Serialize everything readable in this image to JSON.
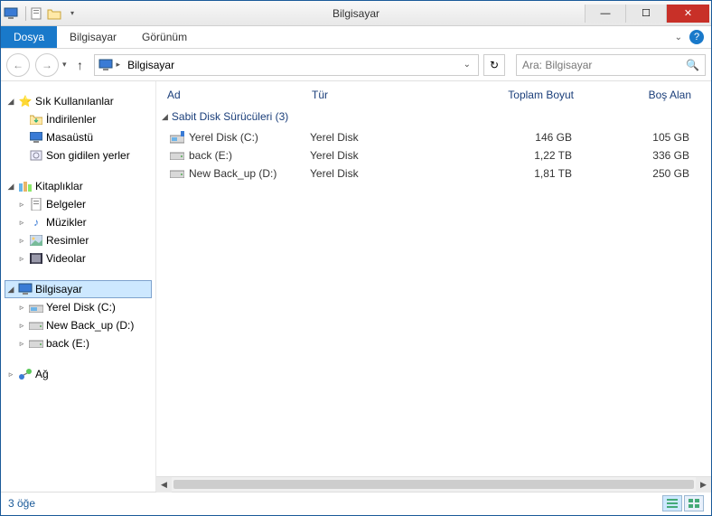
{
  "window": {
    "title": "Bilgisayar"
  },
  "ribbon": {
    "file": "Dosya",
    "tabs": [
      "Bilgisayar",
      "Görünüm"
    ]
  },
  "address": {
    "location": "Bilgisayar"
  },
  "search": {
    "placeholder": "Ara: Bilgisayar"
  },
  "tree": {
    "favorites": {
      "label": "Sık Kullanılanlar",
      "items": [
        {
          "label": "İndirilenler",
          "icon": "download-folder-icon"
        },
        {
          "label": "Masaüstü",
          "icon": "desktop-icon"
        },
        {
          "label": "Son gidilen yerler",
          "icon": "recent-icon"
        }
      ]
    },
    "libraries": {
      "label": "Kitaplıklar",
      "items": [
        {
          "label": "Belgeler",
          "icon": "doc-icon"
        },
        {
          "label": "Müzikler",
          "icon": "music-icon"
        },
        {
          "label": "Resimler",
          "icon": "picture-icon"
        },
        {
          "label": "Videolar",
          "icon": "video-icon"
        }
      ]
    },
    "computer": {
      "label": "Bilgisayar",
      "items": [
        {
          "label": "Yerel Disk (C:)",
          "icon": "disk-icon"
        },
        {
          "label": "New Back_up (D:)",
          "icon": "drive-icon"
        },
        {
          "label": "back (E:)",
          "icon": "drive-icon"
        }
      ]
    },
    "network": {
      "label": "Ağ"
    }
  },
  "columns": {
    "name": "Ad",
    "type": "Tür",
    "total": "Toplam Boyut",
    "free": "Boş Alan"
  },
  "group": {
    "title": "Sabit Disk Sürücüleri (3)"
  },
  "rows": [
    {
      "name": "Yerel Disk (C:)",
      "type": "Yerel Disk",
      "total": "146 GB",
      "free": "105 GB",
      "icon": "disk-primary-icon"
    },
    {
      "name": "back (E:)",
      "type": "Yerel Disk",
      "total": "1,22 TB",
      "free": "336 GB",
      "icon": "drive-icon"
    },
    {
      "name": "New Back_up (D:)",
      "type": "Yerel Disk",
      "total": "1,81 TB",
      "free": "250 GB",
      "icon": "drive-icon"
    }
  ],
  "status": {
    "text": "3 öğe"
  }
}
